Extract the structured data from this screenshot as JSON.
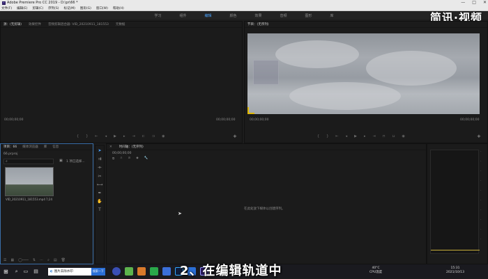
{
  "app": {
    "title": "Adobe Premiere Pro CC 2019 - D:\\pr\\66 *",
    "window_buttons": [
      "—",
      "□",
      "✕"
    ]
  },
  "menu": [
    "文件(F)",
    "编辑(E)",
    "剪辑(C)",
    "序列(S)",
    "标记(M)",
    "图形(G)",
    "窗口(W)",
    "帮助(H)"
  ],
  "workspaces": [
    "学习",
    "组件",
    "编辑",
    "颜色",
    "效果",
    "音频",
    "图形",
    "库"
  ],
  "workspace_active": "编辑",
  "watermark": "简讯·视频",
  "source_panel": {
    "tabs": [
      "源：(无剪辑)",
      "效果控件",
      "音频剪辑混合器: VID_20210911_181553",
      "元数据"
    ],
    "timecode_left": "00;00;00;00",
    "timecode_right": "00;00;00;00"
  },
  "program_panel": {
    "tab": "节目：(无序列)",
    "timecode_left": "00;00;00;00",
    "timecode_right": "00;00;00;00"
  },
  "project_panel": {
    "tabs": [
      "项目：66",
      "媒体浏览器",
      "库",
      "信息"
    ],
    "project_name": "66.prproj",
    "search_placeholder": "",
    "count_label": "1 项已选择...",
    "clip": {
      "name": "VID_20210911_181553.mp4",
      "duration": "7;24"
    }
  },
  "timeline": {
    "tab": "时间轴：(无序列)",
    "timecode": "00;00;00;00",
    "empty_message": "在此处放下媒体以创建序列。"
  },
  "taskbar": {
    "search_text": "图片去除水印",
    "button_text": "搜索一下",
    "weather": "40°C",
    "weather_sub": "CPU温度",
    "time": "15:31",
    "date": "2021/10/13"
  },
  "caption": "2、在编辑轨道中"
}
